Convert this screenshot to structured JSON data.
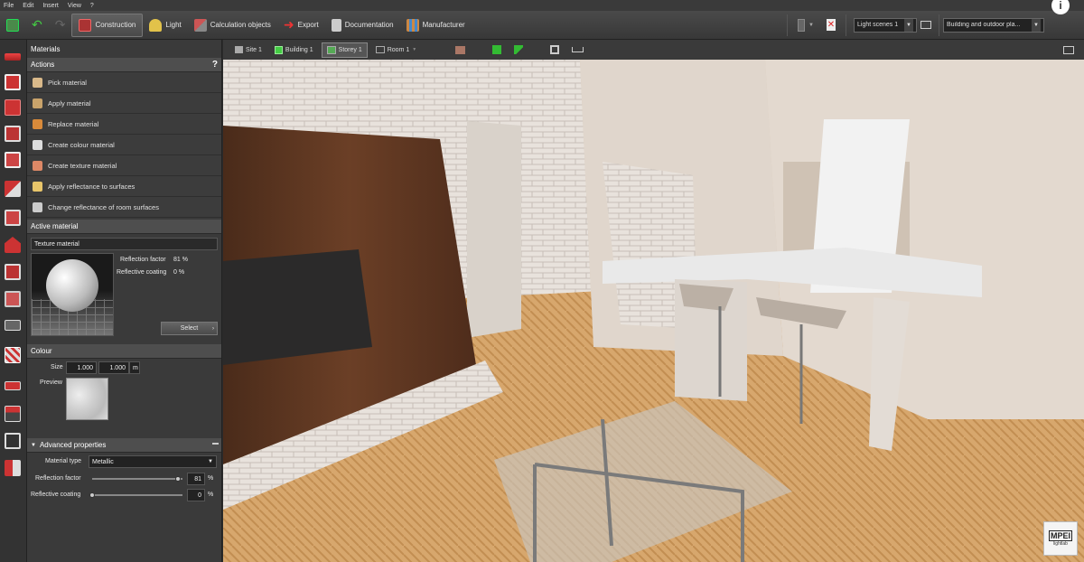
{
  "menu": [
    "File",
    "Edit",
    "Insert",
    "View",
    "?"
  ],
  "toolbar": {
    "tabs": [
      {
        "label": "Construction",
        "active": true,
        "color": "#c0392b"
      },
      {
        "label": "Light",
        "active": false,
        "color": "#e2c24a"
      },
      {
        "label": "Calculation objects",
        "active": false,
        "color": "#b84545"
      },
      {
        "label": "Export",
        "active": false,
        "color": "#d44"
      },
      {
        "label": "Documentation",
        "active": false,
        "color": "#aaa"
      },
      {
        "label": "Manufacturer",
        "active": false,
        "color": "#6a9"
      }
    ],
    "light_scene": "Light scenes 1",
    "plan_select": "Building and outdoor pla..."
  },
  "panel": {
    "title": "Materials",
    "actions_header": "Actions",
    "help": "?",
    "actions": [
      {
        "label": "Pick material",
        "icon": "eyedropper-icon",
        "color": "#d9b98a"
      },
      {
        "label": "Apply material",
        "icon": "brush-icon",
        "color": "#c9a36b"
      },
      {
        "label": "Replace material",
        "icon": "replace-icon",
        "color": "#d98a3a"
      },
      {
        "label": "Create colour material",
        "icon": "palette-icon",
        "color": "#ddd"
      },
      {
        "label": "Create texture material",
        "icon": "texture-icon",
        "color": "#d86"
      },
      {
        "label": "Apply reflectance to surfaces",
        "icon": "bulb-icon",
        "color": "#e8c56a"
      },
      {
        "label": "Change reflectance of room surfaces",
        "icon": "room-reflectance-icon",
        "color": "#ccc"
      }
    ],
    "active_header": "Active material",
    "material_name": "Texture material",
    "reflection_factor_label": "Reflection factor",
    "reflection_factor_value": "81 %",
    "reflective_coating_label": "Reflective coating",
    "reflective_coating_value": "0 %",
    "select_label": "Select",
    "colour_header": "Colour",
    "size_label": "Size",
    "size_x": "1.000",
    "size_y": "1.000",
    "size_unit": "m",
    "preview_label": "Preview",
    "advanced_header": "Advanced properties",
    "material_type_label": "Material type",
    "material_type_value": "Metallic",
    "refl_factor_label": "Reflection factor",
    "refl_factor_num": "81",
    "refl_factor_level": 0.95,
    "refl_coating_label": "Reflective coating",
    "refl_coating_num": "0",
    "refl_coating_level": 0.0,
    "percent": "%"
  },
  "viewtoolbar": {
    "crumbs": [
      {
        "label": "Site 1",
        "active": false
      },
      {
        "label": "Building 1",
        "active": false
      },
      {
        "label": "Storey 1",
        "active": true
      },
      {
        "label": "Room 1",
        "active": false
      }
    ]
  },
  "logo": {
    "text": "MPEI",
    "sub": "lightlab"
  },
  "info": "i"
}
